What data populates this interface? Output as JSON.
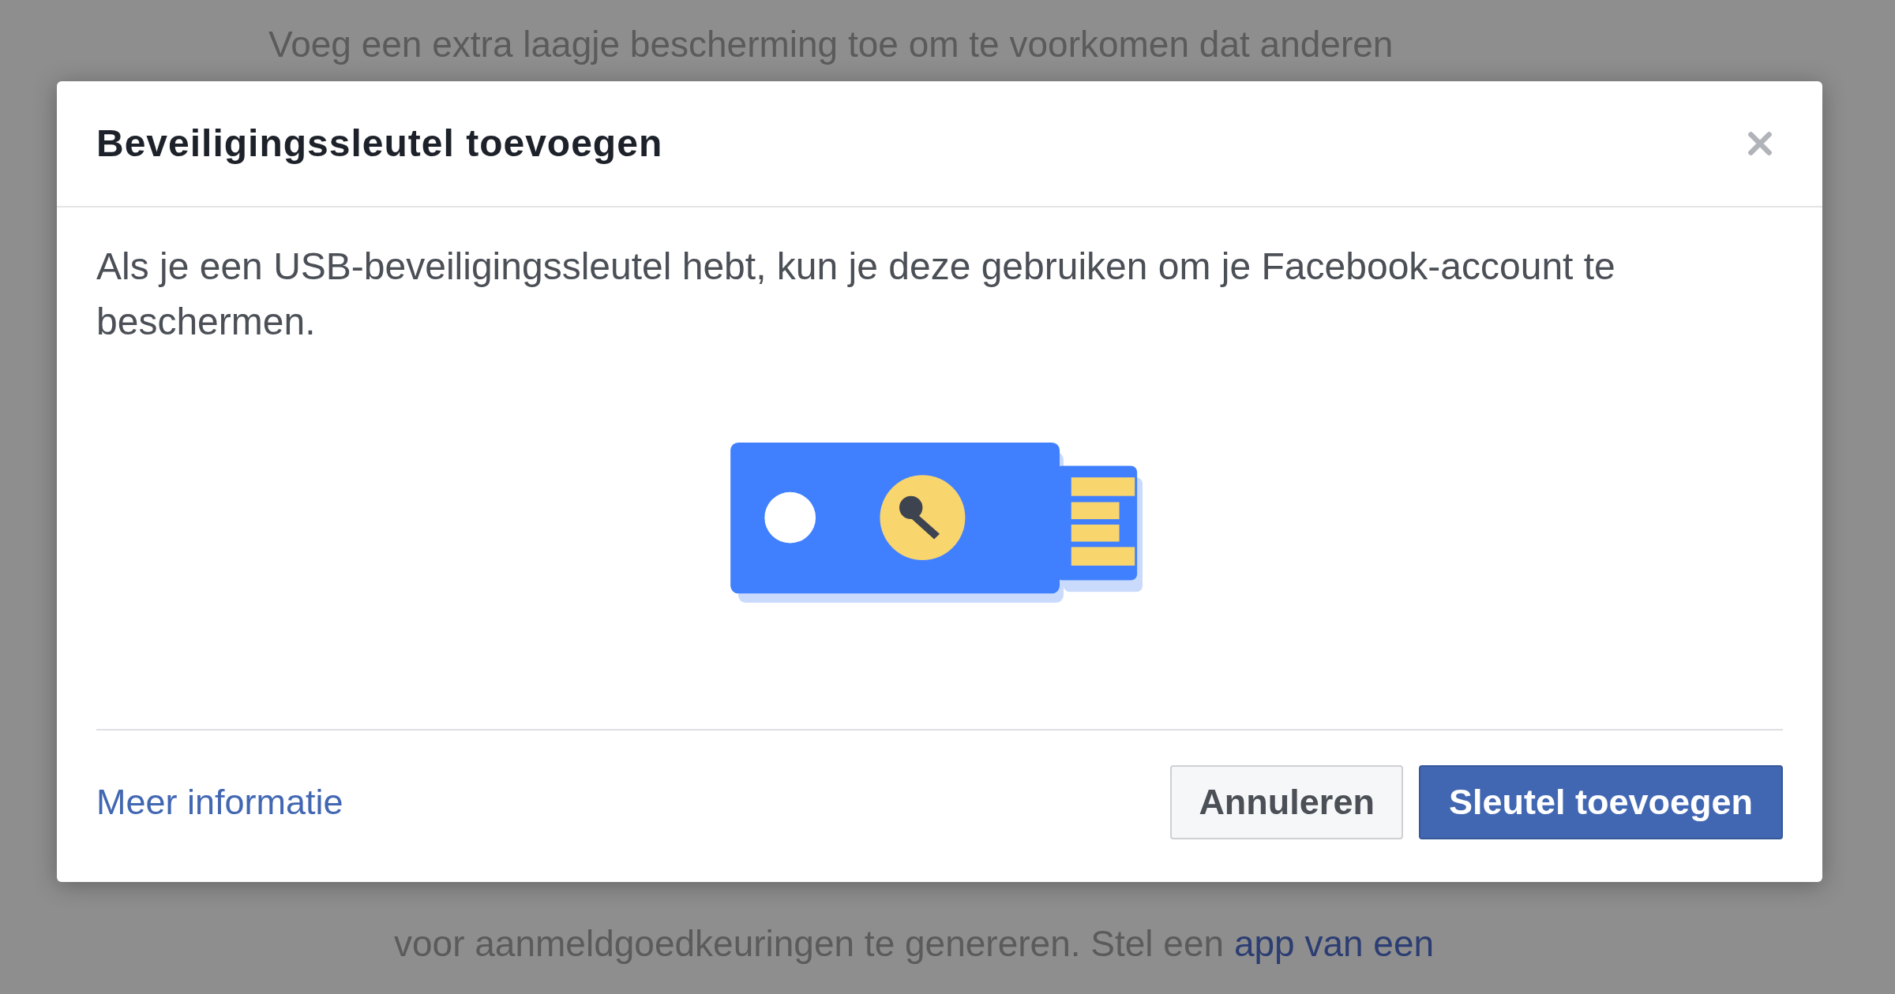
{
  "background_page": {
    "top_line": {
      "text": "Voeg een extra laagje bescherming toe om te voorkomen dat anderen"
    },
    "bottom_line": {
      "text": "voor aanmeldgoedkeuringen te genereren. Stel een ",
      "link": "app van een"
    }
  },
  "dialog": {
    "title": "Beveiligingssleutel toevoegen",
    "body_text": "Als je een USB-beveiligingssleutel hebt, kun je deze gebruiken om je Facebook-account te beschermen.",
    "footer": {
      "link": "Meer informatie",
      "buttons": [
        {
          "label": "Annuleren",
          "kind": "secondary"
        },
        {
          "label": "Sleutel toevoegen",
          "kind": "primary"
        }
      ]
    }
  }
}
